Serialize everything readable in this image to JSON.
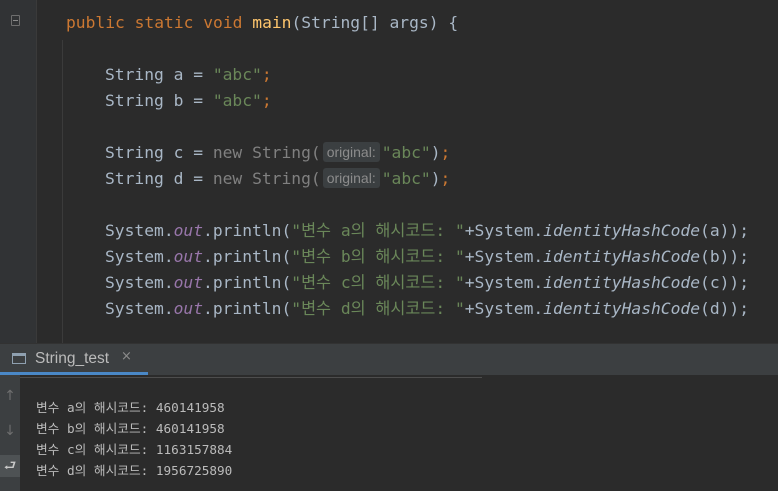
{
  "editor": {
    "code": {
      "sig_kw": "public static void",
      "sig_name": "main",
      "sig_params": "(String[] args) {",
      "a_decl": "String a = ",
      "a_str": "\"abc\"",
      "b_decl": "String b = ",
      "b_str": "\"abc\"",
      "c_decl": "String c = ",
      "d_decl": "String d = ",
      "new_kw": "new",
      "string_ctor": "String(",
      "param_hint": "original:",
      "ctor_str": "\"abc\"",
      "close_paren": ")",
      "semicolon": ";",
      "println_a_str": "\"변수 a의 해시코드: \"",
      "println_b_str": "\"변수 b의 해시코드: \"",
      "println_c_str": "\"변수 c의 해시코드: \"",
      "println_d_str": "\"변수 d의 해시코드: \"",
      "system": "System.",
      "out_field": "out",
      "println_call": ".println(",
      "plus_system": "+System.",
      "identity_method": "identityHashCode",
      "arg_a": "(a));",
      "arg_b": "(b));",
      "arg_c": "(c));",
      "arg_d": "(d));"
    }
  },
  "run_panel": {
    "tab_label": "String_test",
    "close_glyph": "×",
    "toolbar_glyphs": {
      "up": "↑",
      "down": "↓",
      "wrap": "⮐"
    },
    "output": [
      "변수 a의 해시코드: 460141958",
      "변수 b의 해시코드: 460141958",
      "변수 c의 해시코드: 1163157884",
      "변수 d의 해시코드: 1956725890"
    ]
  },
  "colors": {
    "editor_bg": "#2b2b2b",
    "keyword": "#cc7832",
    "string": "#6a8759",
    "method_decl": "#ffc66d",
    "static_field": "#9876aa",
    "tab_accent": "#4a88c7"
  }
}
